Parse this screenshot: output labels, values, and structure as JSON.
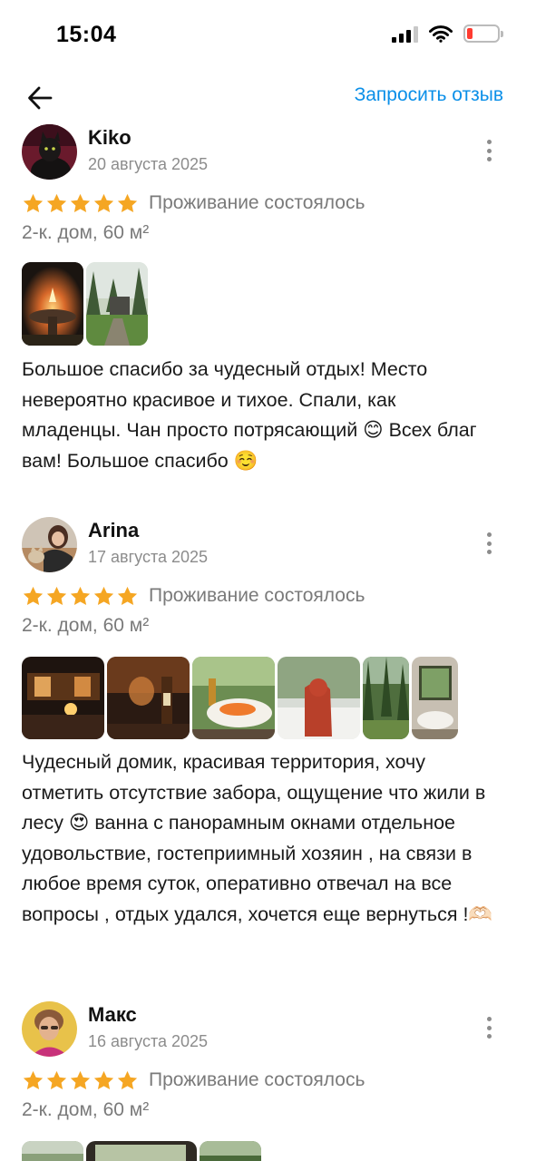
{
  "status_bar": {
    "time": "15:04"
  },
  "header": {
    "request_review": "Запросить отзыв"
  },
  "reviews": [
    {
      "author": "Kiko",
      "date": "20 августа 2025",
      "stay_status": "Проживание состоялось",
      "unit": "2-к. дом, 60 м²",
      "text": "Большое спасибо за чудесный отдых! Место невероятно красивое и тихое. Спали, как младенцы. Чан просто потрясающий 😊 Всех благ вам! Большое спасибо ☺️"
    },
    {
      "author": "Arina",
      "date": "17 августа 2025",
      "stay_status": "Проживание состоялось",
      "unit": "2-к. дом, 60 м²",
      "text": "Чудесный домик, красивая территория,  хочу отметить отсутствие забора, ощущение что жили в лесу 😍 ванна с панорамным окнами отдельное удовольствие, гостеприимный хозяин , на связи в любое время суток, оперативно отвечал на все вопросы , отдых удался, хочется еще вернуться !🫶🏻"
    },
    {
      "author": "Макс",
      "date": "16 августа 2025",
      "stay_status": "Проживание состоялось",
      "unit": "2-к. дом, 60 м²"
    }
  ],
  "colors": {
    "accent": "#0a8fe8",
    "star": "#f5a623",
    "secondary_text": "#7a7a7a"
  },
  "rating": 5
}
